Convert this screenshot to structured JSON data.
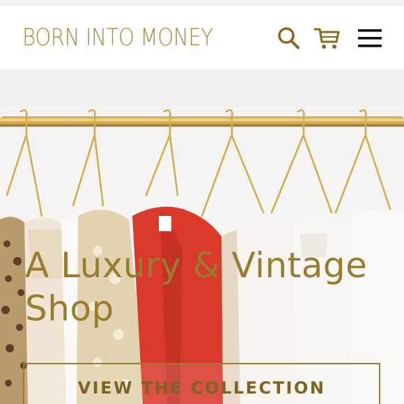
{
  "header": {
    "brand": "BORN INTO MONEY",
    "icons": [
      "search-icon",
      "cart-icon",
      "hamburger-menu-icon"
    ]
  },
  "hero": {
    "headline_line1": "A Luxury & Vintage",
    "headline_line2": "Shop",
    "cta_label": "VIEW THE COLLECTION"
  },
  "colors": {
    "brand_gold": "#a88a3c",
    "headline_gold": "#9a7c2e",
    "rail_gold": "#d2ac52",
    "dress_red": "#d9362a"
  }
}
